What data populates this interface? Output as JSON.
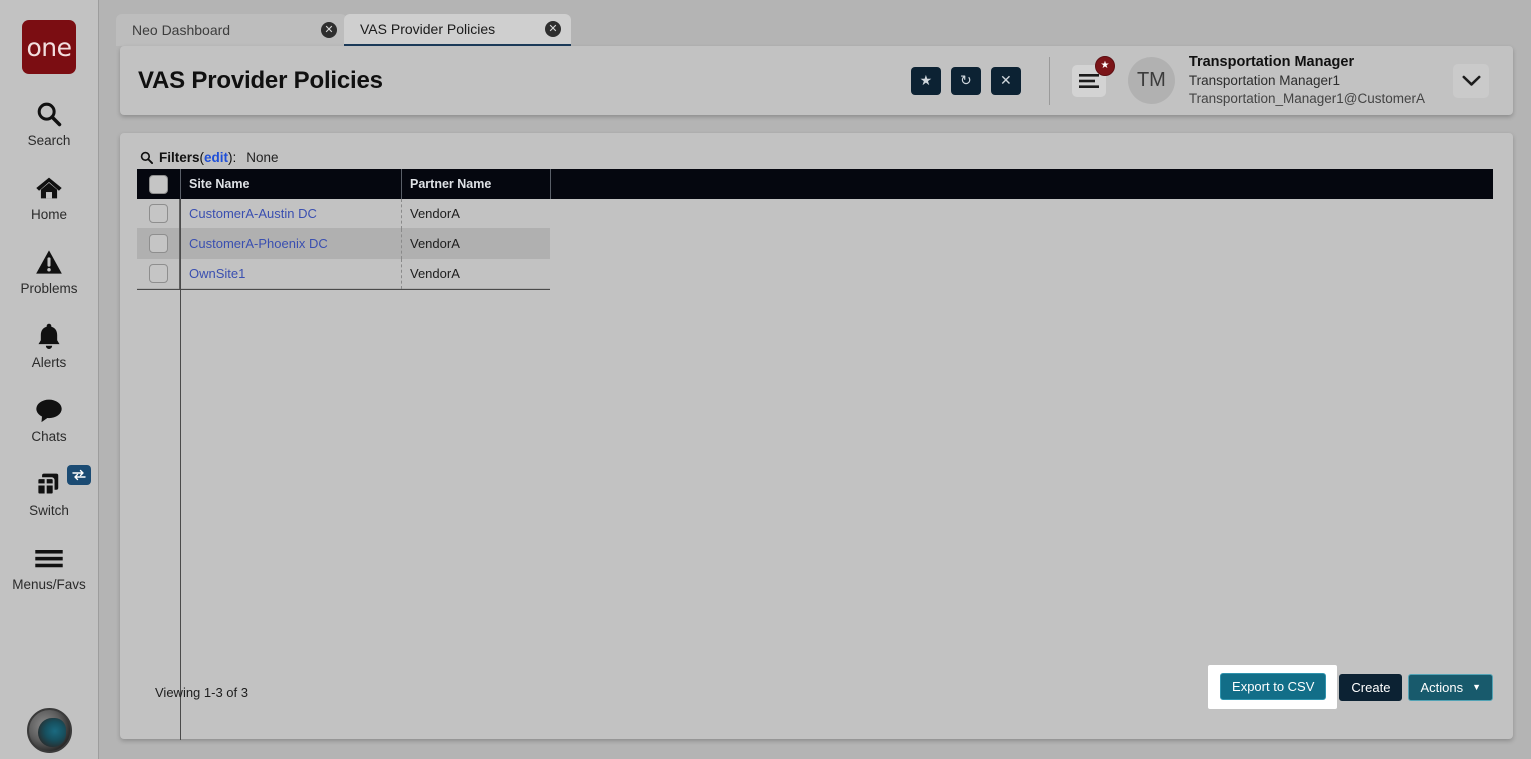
{
  "app": {
    "brand": "one",
    "background_color": "#b4b4b4"
  },
  "sidebar": {
    "items": [
      {
        "icon": "search-icon",
        "label": "Search"
      },
      {
        "icon": "home-icon",
        "label": "Home"
      },
      {
        "icon": "warning-triangle-icon",
        "label": "Problems"
      },
      {
        "icon": "bell-icon",
        "label": "Alerts"
      },
      {
        "icon": "chat-bubble-icon",
        "label": "Chats"
      },
      {
        "icon": "switch-windows-icon",
        "label": "Switch",
        "badge_icon": "swap-arrows-icon"
      },
      {
        "icon": "hamburger-icon",
        "label": "Menus/Favs"
      }
    ],
    "agent_avatar": "agent-avatar-icon"
  },
  "tabs": [
    {
      "title": "Neo Dashboard",
      "active": false,
      "close_icon": "close-circle-icon"
    },
    {
      "title": "VAS Provider Policies",
      "active": true,
      "close_icon": "close-circle-icon"
    }
  ],
  "header": {
    "title": "VAS Provider Policies",
    "buttons": [
      {
        "name": "favorite-button",
        "icon": "star-icon",
        "glyph": "★"
      },
      {
        "name": "refresh-button",
        "icon": "refresh-icon",
        "glyph": "↻"
      },
      {
        "name": "close-button",
        "icon": "close-x-icon",
        "glyph": "✕"
      }
    ],
    "menus_button": {
      "icon": "hamburger-icon",
      "badge_icon": "star-icon",
      "badge_glyph": "★"
    },
    "user": {
      "initials": "TM",
      "role": "Transportation Manager",
      "name": "Transportation Manager1",
      "login": "Transportation_Manager1@CustomerA",
      "caret_icon": "chevron-down-icon"
    }
  },
  "filters": {
    "icon": "search-icon",
    "label": "Filters",
    "edit_label": "edit",
    "open_paren": "(",
    "close_paren": "):",
    "value": "None"
  },
  "table": {
    "columns": [
      "Site Name",
      "Partner Name"
    ],
    "rows": [
      {
        "site_name": "CustomerA-Austin DC",
        "partner_name": "VendorA"
      },
      {
        "site_name": "CustomerA-Phoenix DC",
        "partner_name": "VendorA"
      },
      {
        "site_name": "OwnSite1",
        "partner_name": "VendorA"
      }
    ],
    "header_background": "#05070f",
    "link_color": "#3a4fb0"
  },
  "footer": {
    "viewing": "Viewing 1-3 of 3",
    "export_label": "Export to CSV",
    "create_label": "Create",
    "actions_label": "Actions",
    "actions_caret": "▼",
    "export_color": "#126e88",
    "create_color": "#0c2233",
    "actions_color": "#185a6c"
  }
}
